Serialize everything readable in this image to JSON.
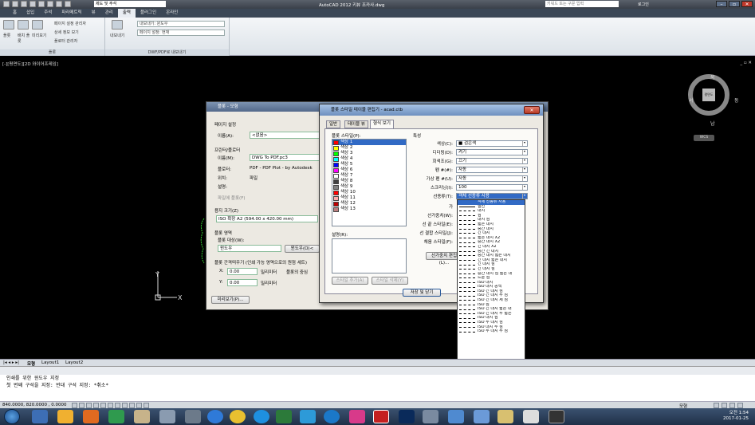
{
  "titlebar": {
    "workspace": "제도 및 주석",
    "title": "AutoCAD 2012   키뷰 조카사.dwg",
    "search_placeholder": "키워드 또는 구문 입력",
    "login": "로그인"
  },
  "menu": [
    "홈",
    "삽입",
    "주석",
    "파라메트릭",
    "뷰",
    "관리",
    "출력",
    "플러그인",
    "온라인"
  ],
  "menu_active_index": 6,
  "ribbon": {
    "plot_panel": {
      "big_buttons": [
        "플롯",
        "배치 플롯",
        "미리보기"
      ],
      "small_buttons": [
        "페이지 설정 관리자",
        "상세 정보 보기",
        "플로터 관리자"
      ],
      "footer": "플롯"
    },
    "export_panel": {
      "big_button": "내보내기",
      "combo1": "내보내기: 윈도우",
      "combo2": "페이지 설정: 현재",
      "footer": "DWF/PDF로 내보내기"
    }
  },
  "viewport": {
    "label": "[-][평면도][2D 와이어프레임]",
    "controls": "_ ▫ ✕",
    "cube_face": "평면도",
    "dir_n": "북",
    "dir_s": "남",
    "dir_w": "서",
    "dir_e": "동",
    "wcs": "WCS",
    "ucs_y": "Y",
    "ucs_x": "X"
  },
  "plot_dialog": {
    "title": "플롯 - 모형",
    "page_setup_label": "페이지 설정",
    "name_label": "이름(A):",
    "name_value": "<없음>",
    "printer_group": "프린터/플로터",
    "printer_name_label": "이름(M):",
    "printer_name_value": "DWG To PDF.pc3",
    "plotter_label": "플로터:",
    "plotter_value": "PDF - PDF Plot - by Autodesk",
    "where_label": "위치:",
    "where_value": "파일",
    "desc_label": "설명:",
    "plot_to_file": "파일에 플롯(F)",
    "paper_size_label": "용지 크기(Z)",
    "paper_size_value": "ISO 확장 A2 (594.00 x 420.00 mm)",
    "plot_area_label": "플롯 영역",
    "plot_what_label": "플롯 대상(W):",
    "plot_what_value": "윈도우",
    "window_button": "윈도우(O)<",
    "offset_label": "플롯 간격띄우기 (인쇄 가능 영역으로의 원점 세트)",
    "x_label": "X:",
    "x_value": "0.00",
    "y_label": "Y:",
    "y_value": "0.00",
    "unit": "밀리미터",
    "center_plot": "플롯의 중심",
    "preview_button": "미리보기(P)..."
  },
  "style_dialog": {
    "title": "플롯 스타일 테이블 편집기 - acad.ctb",
    "tabs": [
      "일반",
      "테이블 뷰",
      "형식 보기"
    ],
    "active_tab": 2,
    "styles_label": "플롯 스타일(P):",
    "styles": [
      {
        "name": "색상 1",
        "color": "#ff0000"
      },
      {
        "name": "색상 2",
        "color": "#ffff00"
      },
      {
        "name": "색상 3",
        "color": "#00ff00"
      },
      {
        "name": "색상 4",
        "color": "#00ffff"
      },
      {
        "name": "색상 5",
        "color": "#0000ff"
      },
      {
        "name": "색상 6",
        "color": "#ff00ff"
      },
      {
        "name": "색상 7",
        "color": "#ffffff"
      },
      {
        "name": "색상 8",
        "color": "#414141"
      },
      {
        "name": "색상 9",
        "color": "#808080"
      },
      {
        "name": "색상 10",
        "color": "#ff0000"
      },
      {
        "name": "색상 11",
        "color": "#ffaaaa"
      },
      {
        "name": "색상 12",
        "color": "#bd0000"
      },
      {
        "name": "색상 13",
        "color": "#bd7e7e"
      }
    ],
    "desc_label": "설명(R):",
    "props_label": "특성",
    "props": [
      {
        "label": "색상(C):",
        "value": "■ 검은색"
      },
      {
        "label": "디더링(D):",
        "value": "켜기"
      },
      {
        "label": "회색조(G):",
        "value": "끄기"
      },
      {
        "label": "펜 #(#):",
        "value": "자동"
      },
      {
        "label": "가상 펜 #(U):",
        "value": "자동"
      },
      {
        "label": "스크리닝(I):",
        "value": "100"
      },
      {
        "label": "선종류(T):",
        "value": "객체 선종류 사용"
      }
    ],
    "more_props": [
      "가",
      "선가중치(W):",
      "선 끝 스타일(E):",
      "선 결합 스타일(J):",
      "채움 스타일(F):"
    ],
    "edit_lw_button": "선가중치 편집(L)...",
    "add_style_button": "스타일 추가(A)",
    "delete_style_button": "스타일 삭제(Y)",
    "save_close_button": "저장 및 닫기"
  },
  "linetype_list": [
    "객체 선종류 사용",
    "실선",
    "대시",
    "점",
    "대시 점",
    "짧은 대시",
    "중간 대시",
    "긴 대시",
    "짧은 대시 X2",
    "중간 대시 X2",
    "긴 대시 X2",
    "중간 긴 대시",
    "중간 대시 짧은 대시",
    "긴 대시 짧은 대시",
    "긴 대시 점",
    "긴 대시 점",
    "중간 대시 점 짧은 대",
    "드문 점",
    "ISO 대시",
    "ISO 대시 공백",
    "ISO 긴 대시 점",
    "ISO 긴 대시 두 점",
    "ISO 긴 대시 세 점",
    "ISO 점",
    "ISO 긴 대시 짧은 대",
    "ISO 긴 대시 두 짧은",
    "ISO 대시 점",
    "ISO 두 대시 점",
    "ISO 대시 두 점",
    "ISO 두 대시 두 점"
  ],
  "linetype_selected_index": 0,
  "layout_tabs": [
    "모형",
    "Layout1",
    "Layout2"
  ],
  "command": {
    "line1": "인쇄를 위한 윈도우 지정",
    "line2": "첫 번째 구석을 지정: 반대 구석 지정: *취소*"
  },
  "status": {
    "coords": "840.0000, 820.0000 , 0.0000",
    "model_label": "모형"
  },
  "clock": {
    "time": "오전 1:54",
    "date": "2017-01-25"
  }
}
